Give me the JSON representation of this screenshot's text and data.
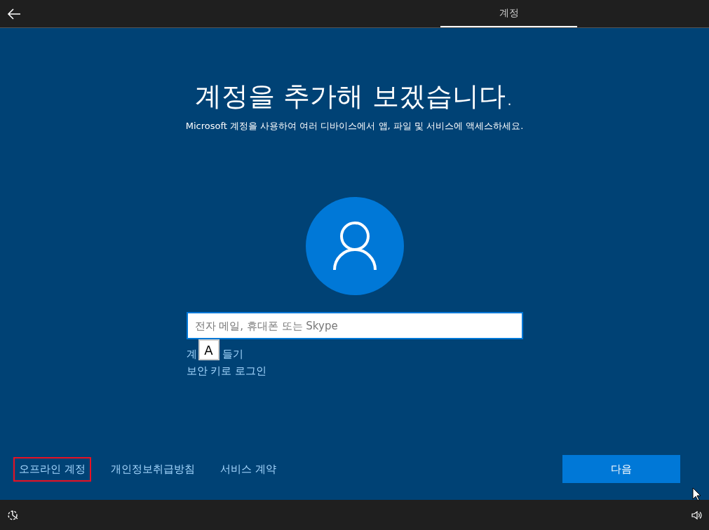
{
  "top_bar": {
    "tabs": [
      {
        "label": "계정",
        "selected": true
      }
    ]
  },
  "heading": "계정을 추가해 보겠습니다.",
  "subtitle": "Microsoft 계정을 사용하여 여러 디바이스에서 앱, 파일 및 서비스에 액세스하세요.",
  "sign_in_field": {
    "placeholder": "전자 메일, 휴대폰 또는 Skype"
  },
  "ime_indicator": "A",
  "create_account_link": {
    "visible_parts": [
      "계",
      "들기"
    ]
  },
  "security_key_link": "보안 키로 로그인",
  "footer_links": [
    {
      "label": "오프라인 계정",
      "highlighted": true
    },
    {
      "label": "개인정보취급방침",
      "highlighted": false
    },
    {
      "label": "서비스 계약",
      "highlighted": false
    }
  ],
  "next_button": "다음"
}
